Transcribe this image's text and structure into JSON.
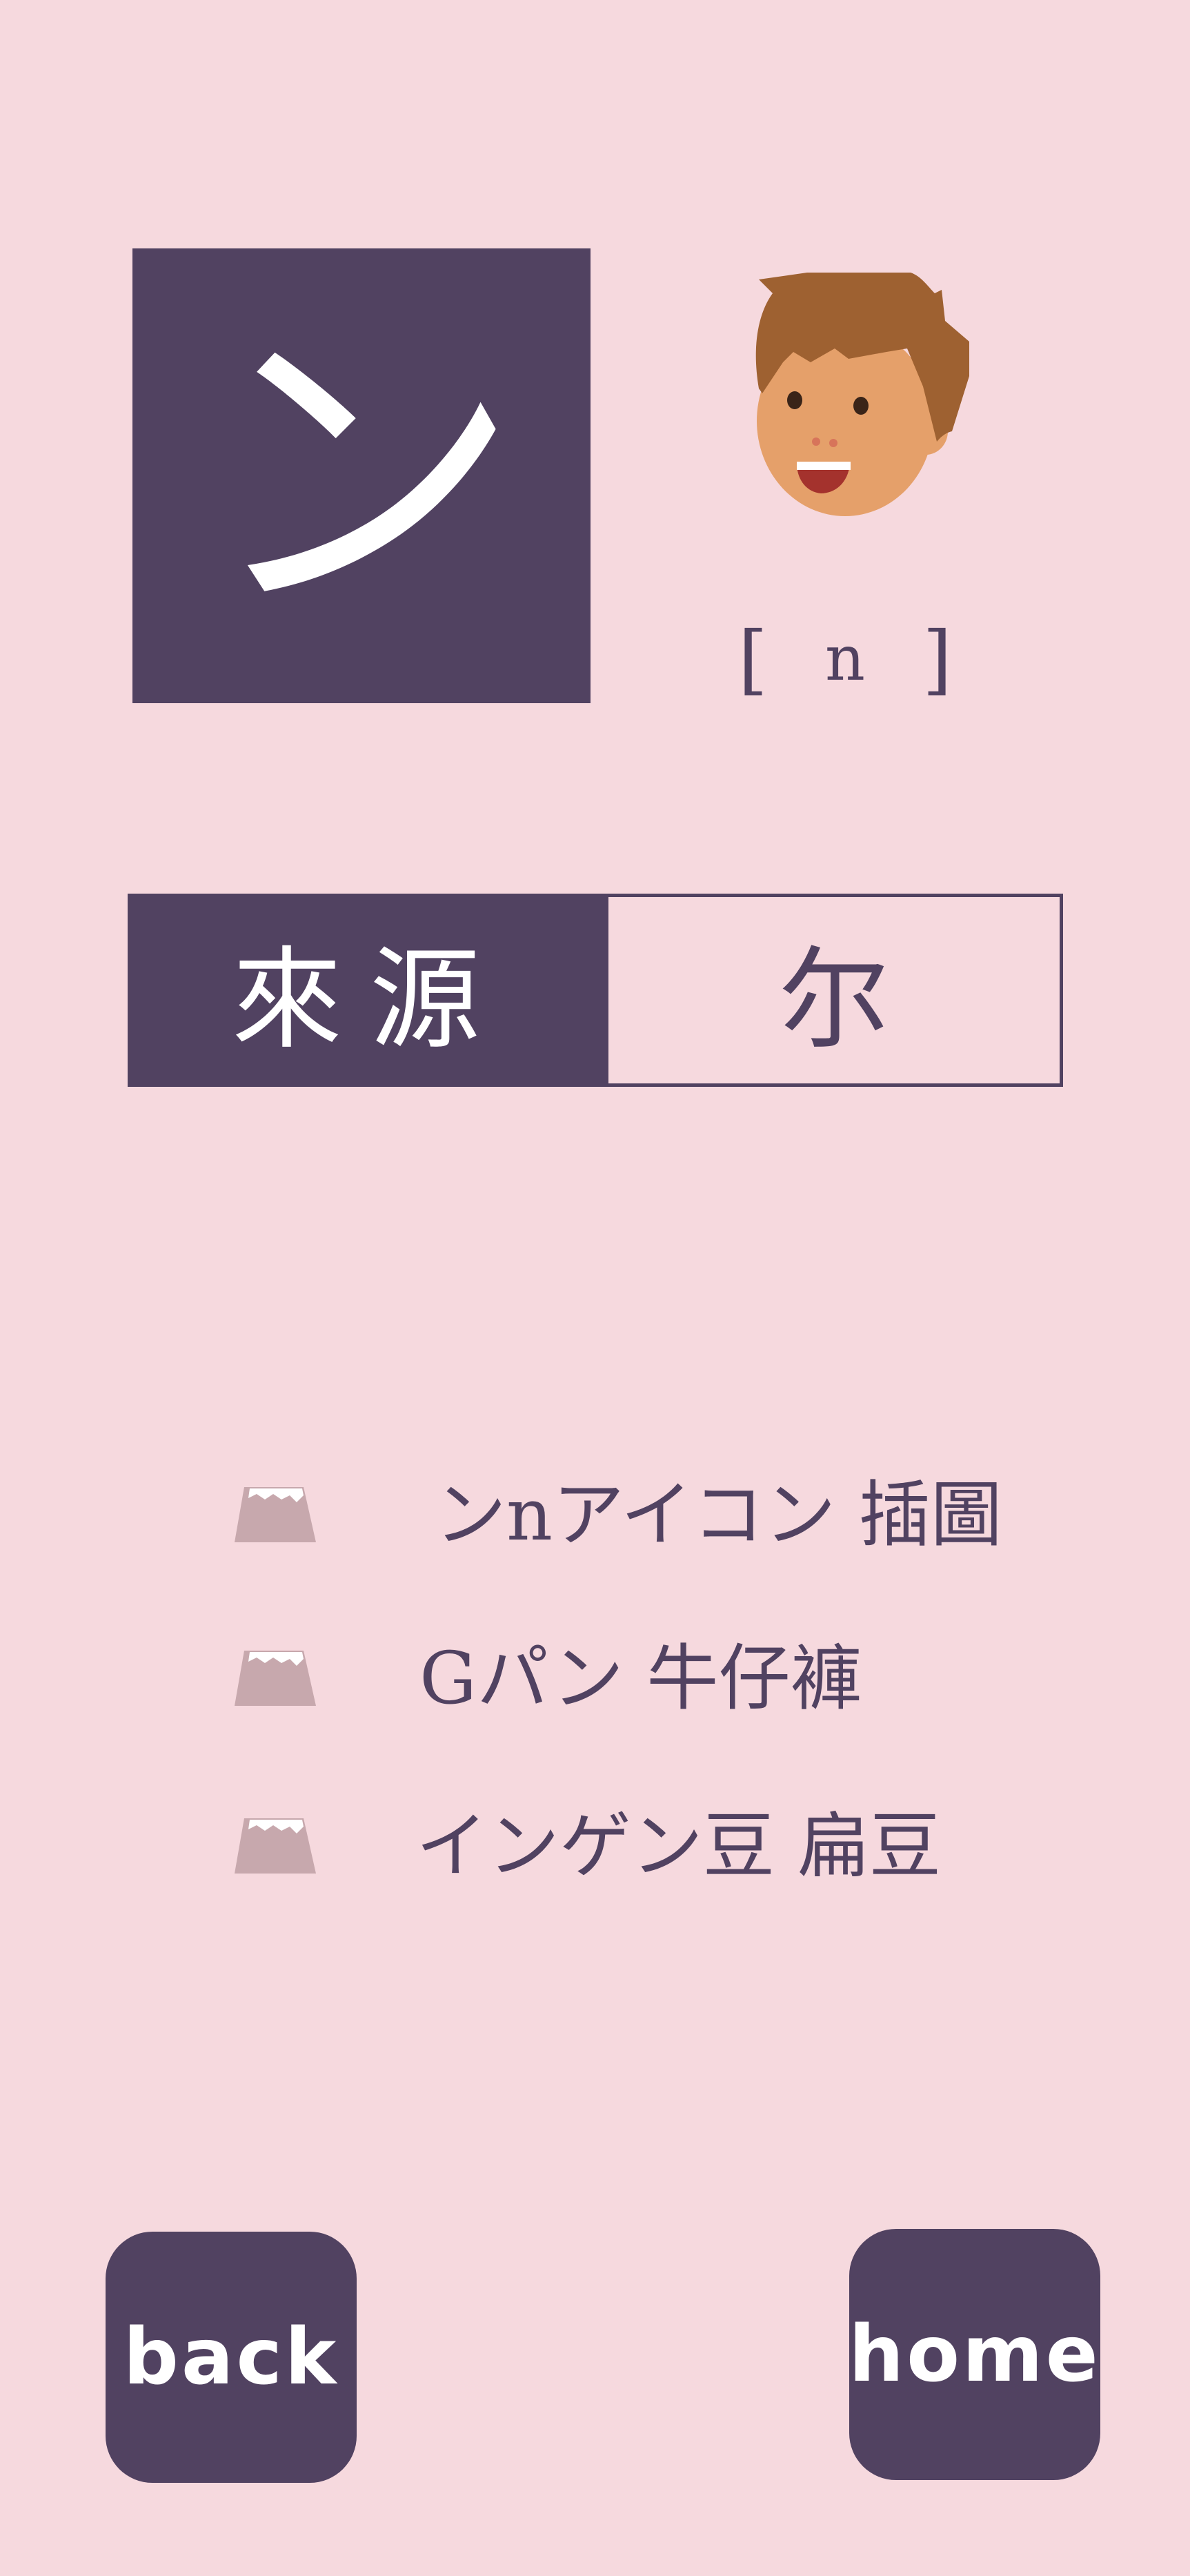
{
  "kana": {
    "character": "ン",
    "pronunciation": {
      "open": "[",
      "romaji": "n",
      "close": "]"
    },
    "avatar_icon": "boy-face-icon"
  },
  "origin": {
    "label": "來源",
    "value": "尔"
  },
  "examples": [
    {
      "icon": "mount-fuji-icon",
      "text": "ンnアイコン 插圖"
    },
    {
      "icon": "mount-fuji-icon",
      "text": "Gパン 牛仔褲"
    },
    {
      "icon": "mount-fuji-icon",
      "text": "インゲン豆 扁豆"
    }
  ],
  "nav": {
    "back_label": "back",
    "home_label": "home"
  },
  "colors": {
    "background": "#f6d9de",
    "primary": "#514261",
    "text_on_primary": "#ffffff",
    "mountain": "#c7a8ad"
  }
}
